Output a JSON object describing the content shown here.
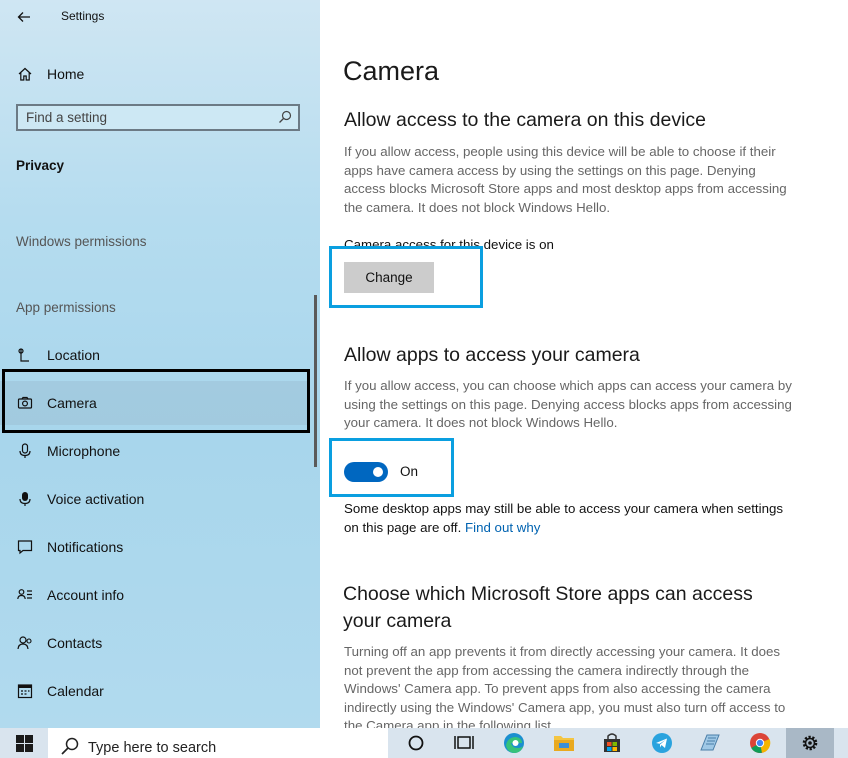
{
  "window": {
    "title": "Settings"
  },
  "sidebar": {
    "home_label": "Home",
    "search_placeholder": "Find a setting",
    "section_title": "Privacy",
    "windows_permissions_heading": "Windows permissions",
    "app_permissions_heading": "App permissions",
    "items": [
      {
        "label": "Location",
        "icon": "location-icon"
      },
      {
        "label": "Camera",
        "icon": "camera-icon",
        "selected": true
      },
      {
        "label": "Microphone",
        "icon": "microphone-icon"
      },
      {
        "label": "Voice activation",
        "icon": "voice-activation-icon"
      },
      {
        "label": "Notifications",
        "icon": "notifications-icon"
      },
      {
        "label": "Account info",
        "icon": "account-info-icon"
      },
      {
        "label": "Contacts",
        "icon": "contacts-icon"
      },
      {
        "label": "Calendar",
        "icon": "calendar-icon"
      }
    ]
  },
  "main": {
    "title": "Camera",
    "device_section": {
      "heading": "Allow access to the camera on this device",
      "description": "If you allow access, people using this device will be able to choose if their apps have camera access by using the settings on this page. Denying access blocks Microsoft Store apps and most desktop apps from accessing the camera. It does not block Windows Hello.",
      "status": "Camera access for this device is on",
      "change_button": "Change"
    },
    "apps_section": {
      "heading": "Allow apps to access your camera",
      "description": "If you allow access, you can choose which apps can access your camera by using the settings on this page. Denying access blocks apps from accessing your camera. It does not block Windows Hello.",
      "toggle_state": "On",
      "toggle_on": true,
      "note": "Some desktop apps may still be able to access your camera when settings on this page are off.",
      "note_link": "Find out why"
    },
    "store_section": {
      "heading": "Choose which Microsoft Store apps can access your camera",
      "description": "Turning off an app prevents it from directly accessing your camera. It does not prevent the app from accessing the camera indirectly through the Windows' Camera app. To prevent apps from also accessing the camera indirectly using the Windows' Camera app, you must also turn off access to the Camera app in the following list."
    }
  },
  "taskbar": {
    "search_text": "Type here to search",
    "apps": [
      "cortana-icon",
      "task-view-icon",
      "edge-icon",
      "file-explorer-icon",
      "store-icon",
      "telegram-icon",
      "notes-icon",
      "chrome-icon",
      "settings-icon"
    ]
  },
  "colors": {
    "accent": "#0067c0",
    "highlight_blue": "#0a9fe0",
    "highlight_black": "#000000",
    "link": "#0063b1"
  }
}
